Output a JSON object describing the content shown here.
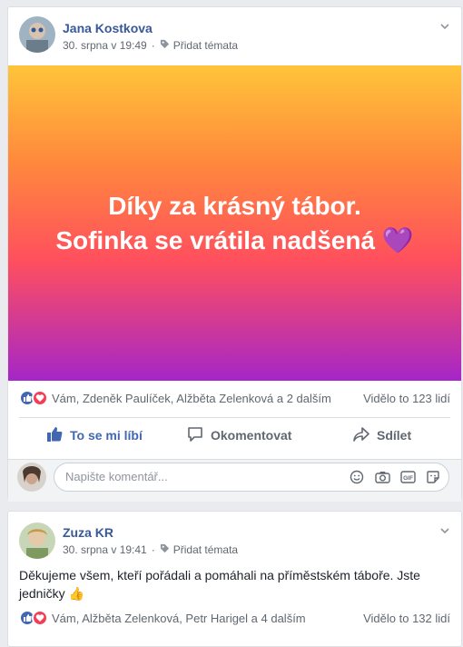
{
  "post1": {
    "author": "Jana Kostkova",
    "date": "30. srpna v 19:49",
    "add_topics": "Přidat témata",
    "banner_line1": "Díky za krásný tábor.",
    "banner_line2": "Sofinka se vrátila nadšená 💜",
    "reactions_text": "Vám, Zdeněk Paulíček, Alžběta Zelenková a 2 dalším",
    "seen_text": "Vidělo to 123 lidí",
    "like_label": "To se mi líbí",
    "comment_label": "Okomentovat",
    "share_label": "Sdílet",
    "comment_placeholder": "Napište komentář..."
  },
  "post2": {
    "author": "Zuza KR",
    "date": "30. srpna v 19:41",
    "add_topics": "Přidat témata",
    "text": "Děkujeme všem, kteří pořádali a pomáhali na příměstském táboře. Jste jedničky 👍",
    "reactions_text": "Vám, Alžběta Zelenková, Petr Harigel a 4 dalším",
    "seen_text": "Vidělo to 132 lidí"
  },
  "colors": {
    "link_blue": "#385898",
    "like_blue": "#4267b2",
    "love_red": "#f33e58",
    "banner_gradient": [
      "#ffc43a",
      "#ff8a3c",
      "#ff4f5e",
      "#a526c8"
    ]
  },
  "icons": [
    "tag-icon",
    "chevron-down-icon",
    "like-reaction-icon",
    "love-reaction-icon",
    "thumbs-up-icon",
    "comment-icon",
    "share-icon",
    "emoji-icon",
    "camera-icon",
    "gif-icon",
    "sticker-icon"
  ]
}
